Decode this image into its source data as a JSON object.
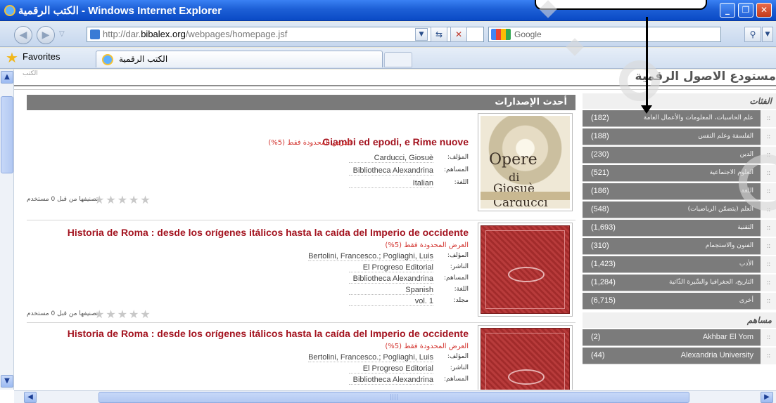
{
  "window": {
    "title": "الكتب الرقمية - Windows Internet Explorer",
    "buttons": {
      "minimize": "_",
      "maximize": "❐",
      "close": "✕"
    }
  },
  "address_bar": {
    "url_prefix": "http://dar.",
    "url_domain": "bibalex.org",
    "url_suffix": "/webpages/homepage.jsf",
    "search_placeholder": "Google"
  },
  "favorites_bar": {
    "favorites_label": "Favorites",
    "tab_label": "الكتب الرقمية"
  },
  "page": {
    "crumb": "الكتب",
    "site_title": "مستودع الاصول الرقمية",
    "latest_header": "أحدث الإصدارات",
    "items": [
      {
        "title": "Giambi ed epodi, e Rime nuove",
        "note": "العرض المحدودة فقط (5%)",
        "meta": [
          {
            "key": "المؤلف:",
            "value": "Carducci, Giosuè"
          },
          {
            "key": "المساهم:",
            "value": "Bibliotheca Alexandrina"
          },
          {
            "key": "اللغة:",
            "value": "Italian"
          }
        ],
        "rating_text": "تصنيفها من قبل 0  مستخدم",
        "cover": {
          "line1": "Opere",
          "line2": "di",
          "line3": "Giosuè Carducci"
        }
      },
      {
        "title": "Historia de Roma : desde los orígenes itálicos hasta la caída del Imperio de occidente",
        "note": "العرض المحدودة فقط (5%)",
        "meta": [
          {
            "key": "المؤلف:",
            "value": "Bertolini, Francesco.; Pogliaghi, Luis"
          },
          {
            "key": "الناشر:",
            "value": "El Progreso Editorial"
          },
          {
            "key": "المساهم:",
            "value": "Bibliotheca Alexandrina"
          },
          {
            "key": "اللغة:",
            "value": "Spanish"
          },
          {
            "key": "مجلد:",
            "value": "vol. 1"
          }
        ],
        "rating_text": "تصنيفها من قبل 0  مستخدم"
      },
      {
        "title": "Historia de Roma : desde los orígenes itálicos hasta la caída del Imperio de occidente",
        "note": "العرض المحدودة فقط (5%)",
        "meta": [
          {
            "key": "المؤلف:",
            "value": "Bertolini, Francesco.; Pogliaghi, Luis"
          },
          {
            "key": "الناشر:",
            "value": "El Progreso Editorial"
          },
          {
            "key": "المساهم:",
            "value": "Bibliotheca Alexandrina"
          }
        ]
      }
    ]
  },
  "sidebar": {
    "categories_title": "الفئات",
    "categories": [
      {
        "count": "(182)",
        "name": "علم الحاسبات، المعلومات والأعمال العامة"
      },
      {
        "count": "(188)",
        "name": "الفلسفة وعلم النفس"
      },
      {
        "count": "(230)",
        "name": "الدين"
      },
      {
        "count": "(521)",
        "name": "العلوم الاجتماعية"
      },
      {
        "count": "(186)",
        "name": "اللغة"
      },
      {
        "count": "(548)",
        "name": "العلم (يتضمّن الرياضيات)"
      },
      {
        "count": "(1,693)",
        "name": "التقنية"
      },
      {
        "count": "(310)",
        "name": "الفنون والاستجمام"
      },
      {
        "count": "(1,423)",
        "name": "الأدب"
      },
      {
        "count": "(1,284)",
        "name": "التاريخ، الجغرافيا والسِّيرة الذّاتية"
      },
      {
        "count": "(6,715)",
        "name": "أخرى"
      }
    ],
    "contributors_title": "مساهم",
    "contributors": [
      {
        "count": "(2)",
        "name": "Akhbar El Yom"
      },
      {
        "count": "(44)",
        "name": "Alexandria University"
      }
    ],
    "grip": "::"
  },
  "colors": {
    "title_bar": "#1d5fd6",
    "item_title": "#a3131f",
    "note": "#d2322d",
    "sidebar_row": "#7b7b7b"
  }
}
